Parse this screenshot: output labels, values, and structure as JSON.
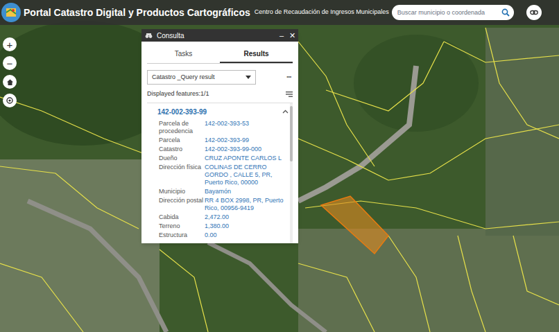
{
  "header": {
    "title": "Portal Catastro Digital y Productos Cartográficos",
    "subtitle": "Centro de Recaudación de Ingresos Municipales"
  },
  "search": {
    "placeholder": "Buscar municipio o coordenada"
  },
  "zoom_controls": [
    "+",
    "−"
  ],
  "panel": {
    "title": "Consulta",
    "controls": [
      "–",
      "✕"
    ],
    "tabs": [
      {
        "label": "Tasks",
        "selected": false
      },
      {
        "label": "Results",
        "selected": true
      }
    ],
    "dropdown": "Catastro _Query result",
    "more": "•••",
    "displayed": "Displayed features:1/1",
    "feature": {
      "title": "142-002-393-99",
      "expanded": true,
      "rows": [
        {
          "label": "Parcela de procedencia",
          "value": "142-002-393-53"
        },
        {
          "label": "Parcela",
          "value": "142-002-393-99"
        },
        {
          "label": "Catastro",
          "value": "142-002-393-99-000"
        },
        {
          "label": "Dueño",
          "value": "CRUZ APONTE CARLOS L"
        },
        {
          "label": "Dirección física",
          "value": "COLINAS DE CERRO GORDO , CALLE 5, PR, Puerto Rico, 00000"
        },
        {
          "label": "Municipio",
          "value": "Bayamón"
        },
        {
          "label": "Dirección postal",
          "value": "RR 4 BOX 2998, PR, Puerto Rico, 00956-9419"
        },
        {
          "label": "Cabida",
          "value": "2,472.00"
        },
        {
          "label": "Terreno",
          "value": "1,380.00"
        },
        {
          "label": "Estructura",
          "value": "0.00"
        }
      ]
    }
  }
}
